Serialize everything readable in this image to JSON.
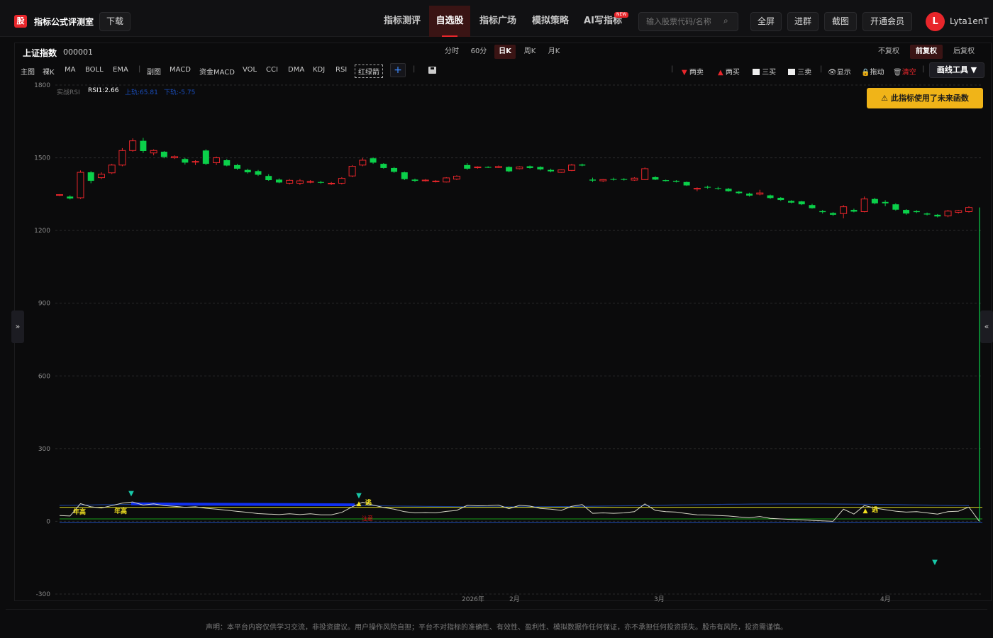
{
  "app": {
    "logo_glyph": "股",
    "title": "指标公式评测室",
    "download_label": "下载"
  },
  "nav": {
    "items": [
      {
        "label": "指标测评"
      },
      {
        "label": "自选股"
      },
      {
        "label": "指标广场"
      },
      {
        "label": "模拟策略"
      },
      {
        "label": "AI写指标"
      }
    ],
    "active": "自选股",
    "new_badge": "NEW"
  },
  "search": {
    "placeholder": "输入股票代码/名称"
  },
  "toolbar_right": {
    "fullscreen": "全屏",
    "group": "进群",
    "screenshot": "截图",
    "membership": "开通会员"
  },
  "user": {
    "initial": "L",
    "name": "Lyta1enT"
  },
  "stock": {
    "name": "上证指数",
    "code": "000001"
  },
  "periods": {
    "items": [
      "分时",
      "60分",
      "日K",
      "周K",
      "月K"
    ],
    "active": "日K"
  },
  "adjust": {
    "items": [
      "不复权",
      "前复权",
      "后复权"
    ],
    "active": "前复权"
  },
  "indicators": {
    "items": [
      "主图",
      "裸K",
      "MA",
      "BOLL",
      "EMA",
      "副图",
      "MACD",
      "资金MACD",
      "VOL",
      "CCI",
      "DMA",
      "KDJ",
      "RSI"
    ],
    "custom": "红绿箭"
  },
  "signal_tools": {
    "two_sell": "两卖",
    "two_buy": "两买",
    "three_buy": "三买",
    "three_sell": "三卖",
    "show": "显示",
    "drag": "拖动",
    "clear": "清空",
    "draw_tools": "画线工具 ▼"
  },
  "warning": "此指标使用了未来函数",
  "legend": {
    "name": "实战RSI",
    "rsi": "RSI1:2.66",
    "upper": "上轨:65.81",
    "lower": "下轨:-5.75"
  },
  "annotations": {
    "year_high_1": "年高",
    "year_high_2": "年高",
    "escape_1": "逃",
    "escape_2": "逃",
    "red_label": "注意"
  },
  "icons": {
    "search": "search-icon",
    "sell_arrow": "down-triangle-icon",
    "buy_arrow": "up-triangle-icon",
    "eye": "eye-icon",
    "lock": "lock-icon",
    "trash": "trash-icon",
    "warning": "warning-icon",
    "expand_left": "double-chevron-right-icon",
    "expand_right": "double-chevron-left-icon"
  },
  "colors": {
    "up": "#e8262b",
    "down": "#0bd04a",
    "rsi_line": "#d8d8c8",
    "upper_band": "#1a3d8f",
    "ref_line": "#d8d820",
    "lower_line": "#1aa01a",
    "highlight": "#1030f0",
    "accent": "#e8262b",
    "warning_bg": "#f0b418"
  },
  "chart_data": {
    "type": "candlestick",
    "ylim": [
      -300,
      1800
    ],
    "y_ticks": [
      "1800",
      "1500",
      "1200",
      "900",
      "600",
      "300",
      "0",
      "-300"
    ],
    "x_ticks": [
      "2026年",
      "2月",
      "3月",
      "4月"
    ],
    "grid": true,
    "ohlc": [
      [
        1345,
        1350,
        1342,
        1348
      ],
      [
        1340,
        1345,
        1328,
        1332
      ],
      [
        1335,
        1448,
        1330,
        1440
      ],
      [
        1440,
        1445,
        1395,
        1405
      ],
      [
        1418,
        1440,
        1412,
        1432
      ],
      [
        1438,
        1475,
        1433,
        1470
      ],
      [
        1470,
        1540,
        1465,
        1530
      ],
      [
        1530,
        1580,
        1525,
        1570
      ],
      [
        1570,
        1582,
        1520,
        1528
      ],
      [
        1520,
        1535,
        1510,
        1530
      ],
      [
        1525,
        1528,
        1498,
        1503
      ],
      [
        1500,
        1510,
        1495,
        1505
      ],
      [
        1495,
        1500,
        1472,
        1480
      ],
      [
        1482,
        1490,
        1470,
        1485
      ],
      [
        1530,
        1535,
        1470,
        1475
      ],
      [
        1480,
        1505,
        1470,
        1500
      ],
      [
        1490,
        1495,
        1465,
        1468
      ],
      [
        1470,
        1475,
        1450,
        1455
      ],
      [
        1450,
        1455,
        1435,
        1440
      ],
      [
        1445,
        1450,
        1425,
        1430
      ],
      [
        1425,
        1432,
        1405,
        1408
      ],
      [
        1410,
        1415,
        1395,
        1398
      ],
      [
        1395,
        1412,
        1390,
        1407
      ],
      [
        1395,
        1412,
        1388,
        1405
      ],
      [
        1400,
        1408,
        1395,
        1402
      ],
      [
        1400,
        1405,
        1393,
        1397
      ],
      [
        1392,
        1400,
        1388,
        1395
      ],
      [
        1395,
        1420,
        1390,
        1415
      ],
      [
        1425,
        1470,
        1420,
        1465
      ],
      [
        1470,
        1500,
        1465,
        1490
      ],
      [
        1498,
        1502,
        1475,
        1480
      ],
      [
        1475,
        1478,
        1455,
        1458
      ],
      [
        1458,
        1462,
        1438,
        1442
      ],
      [
        1440,
        1443,
        1408,
        1412
      ],
      [
        1410,
        1414,
        1400,
        1405
      ],
      [
        1405,
        1412,
        1402,
        1408
      ],
      [
        1402,
        1408,
        1398,
        1404
      ],
      [
        1400,
        1420,
        1398,
        1417
      ],
      [
        1412,
        1428,
        1408,
        1424
      ],
      [
        1470,
        1478,
        1450,
        1455
      ],
      [
        1460,
        1465,
        1455,
        1462
      ],
      [
        1462,
        1465,
        1458,
        1460
      ],
      [
        1460,
        1468,
        1458,
        1464
      ],
      [
        1462,
        1465,
        1440,
        1444
      ],
      [
        1455,
        1465,
        1452,
        1462
      ],
      [
        1465,
        1468,
        1455,
        1458
      ],
      [
        1462,
        1465,
        1448,
        1452
      ],
      [
        1450,
        1455,
        1440,
        1444
      ],
      [
        1440,
        1452,
        1438,
        1450
      ],
      [
        1448,
        1475,
        1445,
        1470
      ],
      [
        1472,
        1476,
        1465,
        1468
      ],
      [
        1410,
        1418,
        1400,
        1406
      ],
      [
        1405,
        1412,
        1400,
        1410
      ],
      [
        1412,
        1418,
        1406,
        1410
      ],
      [
        1412,
        1416,
        1406,
        1409
      ],
      [
        1408,
        1420,
        1405,
        1416
      ],
      [
        1410,
        1460,
        1408,
        1455
      ],
      [
        1420,
        1424,
        1408,
        1410
      ],
      [
        1408,
        1410,
        1402,
        1404
      ],
      [
        1405,
        1408,
        1398,
        1401
      ],
      [
        1400,
        1402,
        1384,
        1386
      ],
      [
        1372,
        1378,
        1362,
        1374
      ],
      [
        1380,
        1385,
        1372,
        1378
      ],
      [
        1375,
        1380,
        1368,
        1374
      ],
      [
        1372,
        1376,
        1360,
        1362
      ],
      [
        1360,
        1363,
        1350,
        1354
      ],
      [
        1352,
        1356,
        1340,
        1344
      ],
      [
        1350,
        1368,
        1345,
        1355
      ],
      [
        1345,
        1348,
        1330,
        1334
      ],
      [
        1335,
        1338,
        1322,
        1326
      ],
      [
        1322,
        1325,
        1312,
        1315
      ],
      [
        1320,
        1322,
        1305,
        1308
      ],
      [
        1305,
        1310,
        1290,
        1292
      ],
      [
        1280,
        1285,
        1270,
        1276
      ],
      [
        1272,
        1276,
        1260,
        1265
      ],
      [
        1270,
        1305,
        1250,
        1298
      ],
      [
        1285,
        1290,
        1275,
        1278
      ],
      [
        1278,
        1340,
        1275,
        1330
      ],
      [
        1330,
        1335,
        1308,
        1312
      ],
      [
        1318,
        1325,
        1300,
        1312
      ],
      [
        1308,
        1312,
        1282,
        1286
      ],
      [
        1285,
        1288,
        1265,
        1270
      ],
      [
        1280,
        1284,
        1272,
        1276
      ],
      [
        1270,
        1274,
        1262,
        1266
      ],
      [
        1265,
        1268,
        1254,
        1258
      ],
      [
        1260,
        1285,
        1255,
        1280
      ],
      [
        1275,
        1285,
        1270,
        1282
      ],
      [
        1278,
        1300,
        1274,
        1295
      ]
    ],
    "series": [
      {
        "name": "RSI1",
        "values": [
          24,
          22,
          73,
          60,
          55,
          65,
          75,
          80,
          67,
          72,
          65,
          62,
          58,
          60,
          54,
          50,
          46,
          41,
          37,
          32,
          30,
          28,
          31,
          28,
          31,
          27,
          27,
          37,
          60,
          79,
          67,
          57,
          50,
          40,
          35,
          36,
          35,
          41,
          45,
          66,
          64,
          65,
          67,
          52,
          66,
          63,
          53,
          50,
          45,
          62,
          69,
          33,
          35,
          33,
          35,
          40,
          72,
          45,
          40,
          38,
          32,
          27,
          26,
          24,
          22,
          18,
          15,
          20,
          12,
          10,
          8,
          6,
          4,
          2,
          0,
          50,
          30,
          65,
          55,
          48,
          42,
          38,
          40,
          35,
          30,
          40,
          42,
          59,
          0
        ]
      },
      {
        "name": "上轨",
        "values": [
          65.81
        ]
      },
      {
        "name": "下轨",
        "values": [
          -5.75
        ]
      }
    ],
    "reference_lines": [
      58,
      10,
      -5.75
    ]
  },
  "disclaimer": "声明：本平台内容仅供学习交流，非投资建议。用户操作风险自担；平台不对指标的准确性、有效性、盈利性、模拟数据作任何保证，亦不承担任何投资损失。股市有风险，投资需谨慎。"
}
